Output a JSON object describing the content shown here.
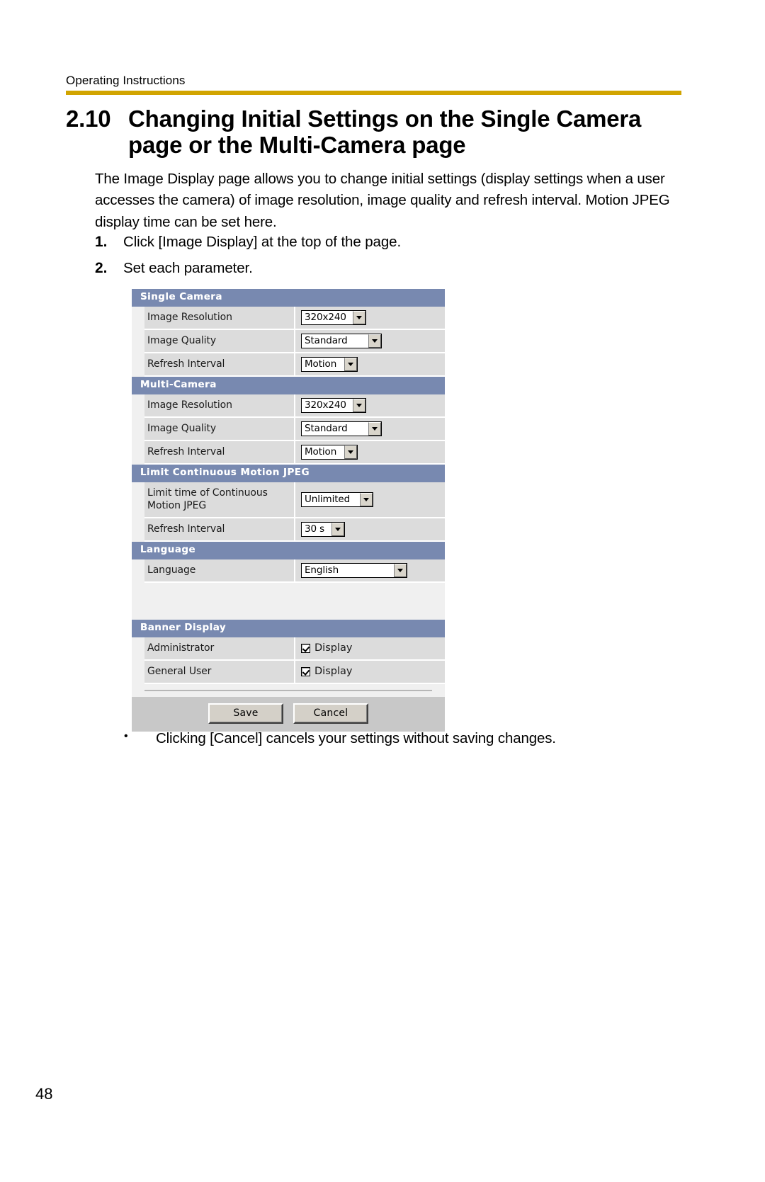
{
  "document": {
    "running_header": "Operating Instructions",
    "page_number": "48",
    "rule_color": "#d1a400"
  },
  "section": {
    "number": "2.10",
    "title": "Changing Initial Settings on the Single Camera page or the Multi-Camera page",
    "intro": "The Image Display page allows you to change initial settings (display settings when a user accesses the camera) of image resolution, image quality and refresh interval. Motion JPEG display time can be set here.",
    "steps": [
      {
        "n": "1.",
        "text": "Click [Image Display] at the top of the page."
      },
      {
        "n": "2.",
        "text": "Set each parameter."
      }
    ],
    "note_bullet": "•",
    "note": "Clicking [Cancel] cancels your settings without saving changes."
  },
  "settings_panel": {
    "header_color": "#7889b0",
    "sections": [
      {
        "title": "Single Camera",
        "rows": [
          {
            "label": "Image Resolution",
            "control": "select",
            "value": "320x240"
          },
          {
            "label": "Image Quality",
            "control": "select",
            "value": "Standard"
          },
          {
            "label": "Refresh Interval",
            "control": "select",
            "value": "Motion"
          }
        ]
      },
      {
        "title": "Multi-Camera",
        "rows": [
          {
            "label": "Image Resolution",
            "control": "select",
            "value": "320x240"
          },
          {
            "label": "Image Quality",
            "control": "select",
            "value": "Standard"
          },
          {
            "label": "Refresh Interval",
            "control": "select",
            "value": "Motion"
          }
        ]
      },
      {
        "title": "Limit Continuous Motion JPEG",
        "rows": [
          {
            "label": "Limit time of Continuous Motion JPEG",
            "control": "select",
            "value": "Unlimited"
          },
          {
            "label": "Refresh Interval",
            "control": "select",
            "value": "30 s"
          }
        ]
      },
      {
        "title": "Language",
        "rows": [
          {
            "label": "Language",
            "control": "select",
            "value": "English"
          }
        ]
      },
      {
        "title": "Banner Display",
        "rows": [
          {
            "label": "Administrator",
            "control": "checkbox",
            "value": "Display",
            "checked": true
          },
          {
            "label": "General User",
            "control": "checkbox",
            "value": "Display",
            "checked": true
          }
        ]
      }
    ],
    "buttons": {
      "save": "Save",
      "cancel": "Cancel"
    }
  }
}
